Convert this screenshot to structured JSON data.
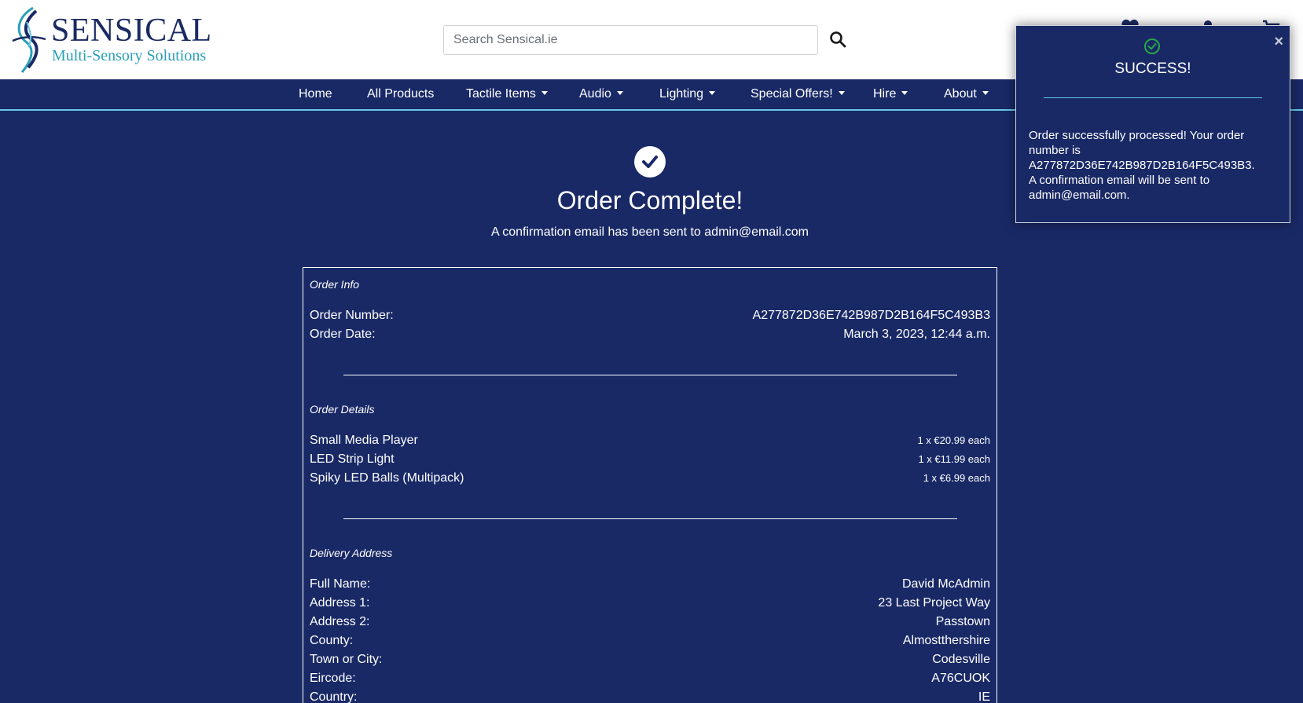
{
  "brand": {
    "name": "SENSICAL",
    "tagline": "Multi-Sensory Solutions"
  },
  "search": {
    "placeholder": "Search Sensical.ie"
  },
  "nav": {
    "home": "Home",
    "all_products": "All Products",
    "tactile": "Tactile Items",
    "audio": "Audio",
    "lighting": "Lighting",
    "offers": "Special Offers!",
    "hire": "Hire",
    "about": "About"
  },
  "confirmation": {
    "title": "Order Complete!",
    "subtitle": "A confirmation email has been sent to admin@email.com"
  },
  "order_info": {
    "heading": "Order Info",
    "number_label": "Order Number:",
    "number_value": "A277872D36E742B987D2B164F5C493B3",
    "date_label": "Order Date:",
    "date_value": "March 3, 2023, 12:44 a.m."
  },
  "order_details": {
    "heading": "Order Details",
    "items": [
      {
        "name": "Small Media Player",
        "qty_price": "1 x €20.99 each"
      },
      {
        "name": "LED Strip Light",
        "qty_price": "1 x €11.99 each"
      },
      {
        "name": "Spiky LED Balls (Multipack)",
        "qty_price": "1 x €6.99 each"
      }
    ]
  },
  "delivery": {
    "heading": "Delivery Address",
    "rows": [
      {
        "label": "Full Name:",
        "value": "David McAdmin"
      },
      {
        "label": "Address 1:",
        "value": "23 Last Project Way"
      },
      {
        "label": "Address 2:",
        "value": "Passtown"
      },
      {
        "label": "County:",
        "value": "Almostthershire"
      },
      {
        "label": "Town or City:",
        "value": "Codesville"
      },
      {
        "label": "Eircode:",
        "value": "A76CUOK"
      },
      {
        "label": "Country:",
        "value": "IE"
      }
    ]
  },
  "toast": {
    "title": "SUCCESS!",
    "message": "Order successfully processed! Your order number is A277872D36E742B987D2B164F5C493B3. A confirmation email will be sent to admin@email.com.",
    "close": "×"
  },
  "colors": {
    "navy": "#192966",
    "accent": "#6ac7e6",
    "success": "#28a745"
  },
  "icons": [
    "logo-swirl-icon",
    "search-icon",
    "heart-icon",
    "user-icon",
    "cart-icon",
    "check-icon",
    "check-circle-icon",
    "close-icon",
    "caret-down-icon"
  ]
}
